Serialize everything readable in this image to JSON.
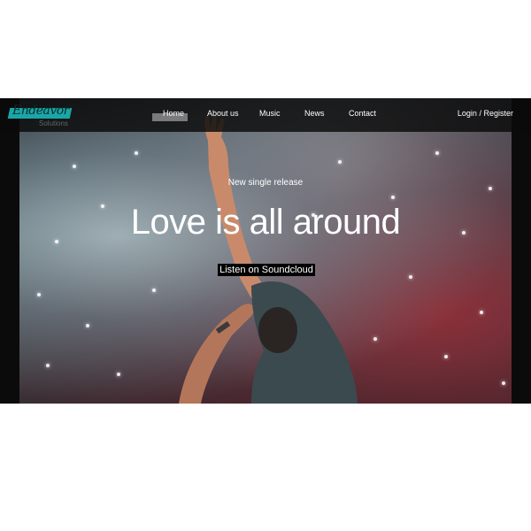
{
  "brand": {
    "logo_text": "Endeavor",
    "logo_subtext": "Solutions",
    "accent": "#1aa6a6"
  },
  "nav": {
    "items": [
      {
        "label": "Home",
        "active": true
      },
      {
        "label": "About us"
      },
      {
        "label": "Music"
      },
      {
        "label": "News"
      },
      {
        "label": "Contact"
      }
    ],
    "login_label": "Login",
    "separator": "/",
    "register_label": "Register"
  },
  "hero": {
    "subtitle": "New single release",
    "headline": "Love is all around",
    "cta_label": "Listen on Soundcloud",
    "image_icon": "concert-photo"
  }
}
